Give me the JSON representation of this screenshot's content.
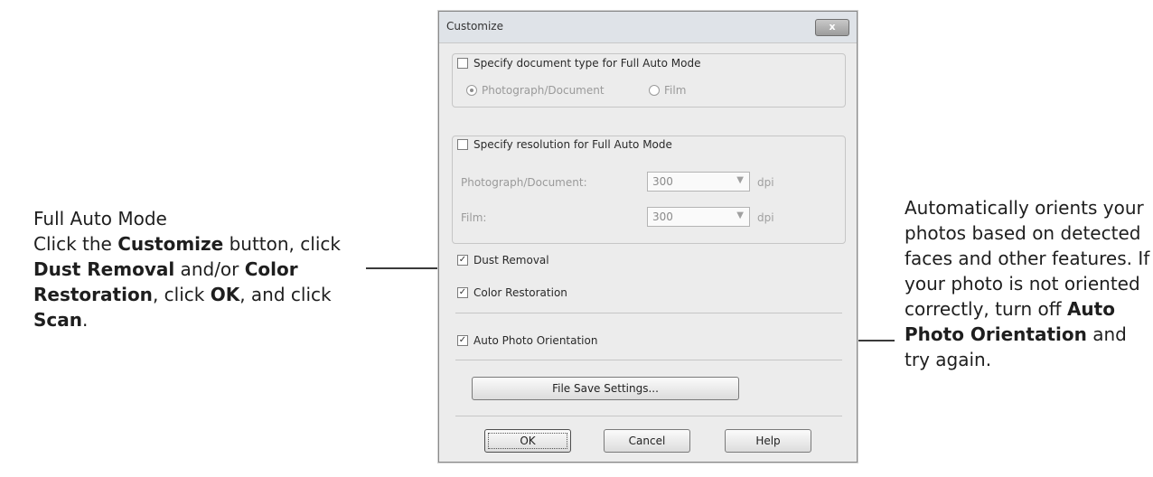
{
  "dialog": {
    "title": "Customize",
    "close_label": "x",
    "doc_type": {
      "checkbox_label": "Specify document type for Full Auto Mode",
      "checked": false,
      "options": [
        "Photograph/Document",
        "Film"
      ],
      "selected": "Photograph/Document"
    },
    "resolution": {
      "checkbox_label": "Specify resolution for Full Auto Mode",
      "checked": false,
      "rows": [
        {
          "label": "Photograph/Document:",
          "value": "300",
          "unit": "dpi"
        },
        {
          "label": "Film:",
          "value": "300",
          "unit": "dpi"
        }
      ]
    },
    "dust_removal": {
      "label": "Dust Removal",
      "checked": true
    },
    "color_restoration": {
      "label": "Color Restoration",
      "checked": true
    },
    "auto_photo_orientation": {
      "label": "Auto Photo Orientation",
      "checked": true
    },
    "file_save_button": "File Save Settings...",
    "ok_button": "OK",
    "cancel_button": "Cancel",
    "help_button": "Help"
  },
  "left_callout": {
    "heading": "Full Auto Mode",
    "t1": "Click the ",
    "b1": "Customize",
    "t2": " button, click ",
    "b2": "Dust Removal",
    "t3": " and/or ",
    "b3": "Color Restoration",
    "t4": ", click ",
    "b4": "OK",
    "t5": ", and click ",
    "b5": "Scan",
    "t6": "."
  },
  "right_callout": {
    "t1": "Automatically orients your photos based on detected faces and other features. If your photo is not oriented correctly, turn off ",
    "b1": "Auto Photo Orientation",
    "t2": " and try again."
  },
  "colors": {
    "dialog_bg": "#ececec",
    "titlebar": "#dfe3e8",
    "disabled_text": "#9a9a9a"
  }
}
